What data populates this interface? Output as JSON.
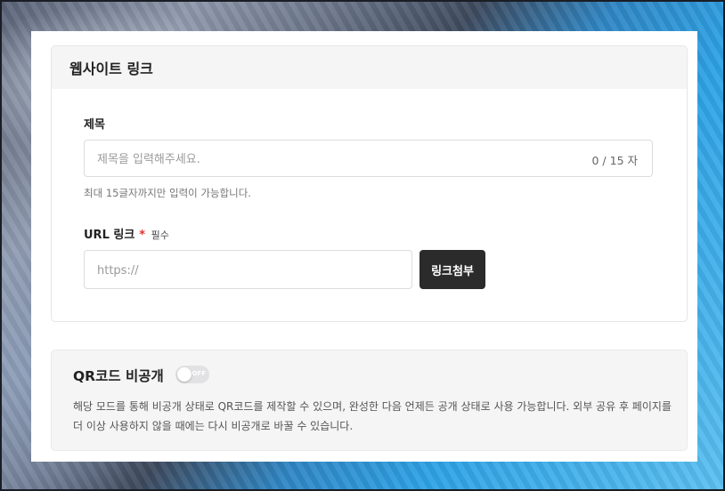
{
  "website_link": {
    "section_title": "웹사이트 링크",
    "title_label": "제목",
    "title_placeholder": "제목을 입력해주세요.",
    "title_counter": "0 / 15 자",
    "title_hint": "최대 15글자까지만 입력이 가능합니다.",
    "url_label": "URL 링크",
    "required_star": "*",
    "required_text": "필수",
    "url_placeholder": "https://",
    "attach_button": "링크첨부"
  },
  "qr_private": {
    "title": "QR코드 비공개",
    "toggle_state": "OFF",
    "toggle_on": false,
    "description": "해당 모드를 통해 비공개 상태로 QR코드를 제작할 수 있으며, 완성한 다음 언제든 공개 상태로 사용 가능합니다. 외부 공유 후 페이지를 더 이상 사용하지 않을 때에는 다시 비공개로 바꿀 수 있습니다."
  },
  "colors": {
    "button_bg": "#2b2b2b",
    "required": "#e0302f",
    "card_header_bg": "#f5f5f6"
  }
}
